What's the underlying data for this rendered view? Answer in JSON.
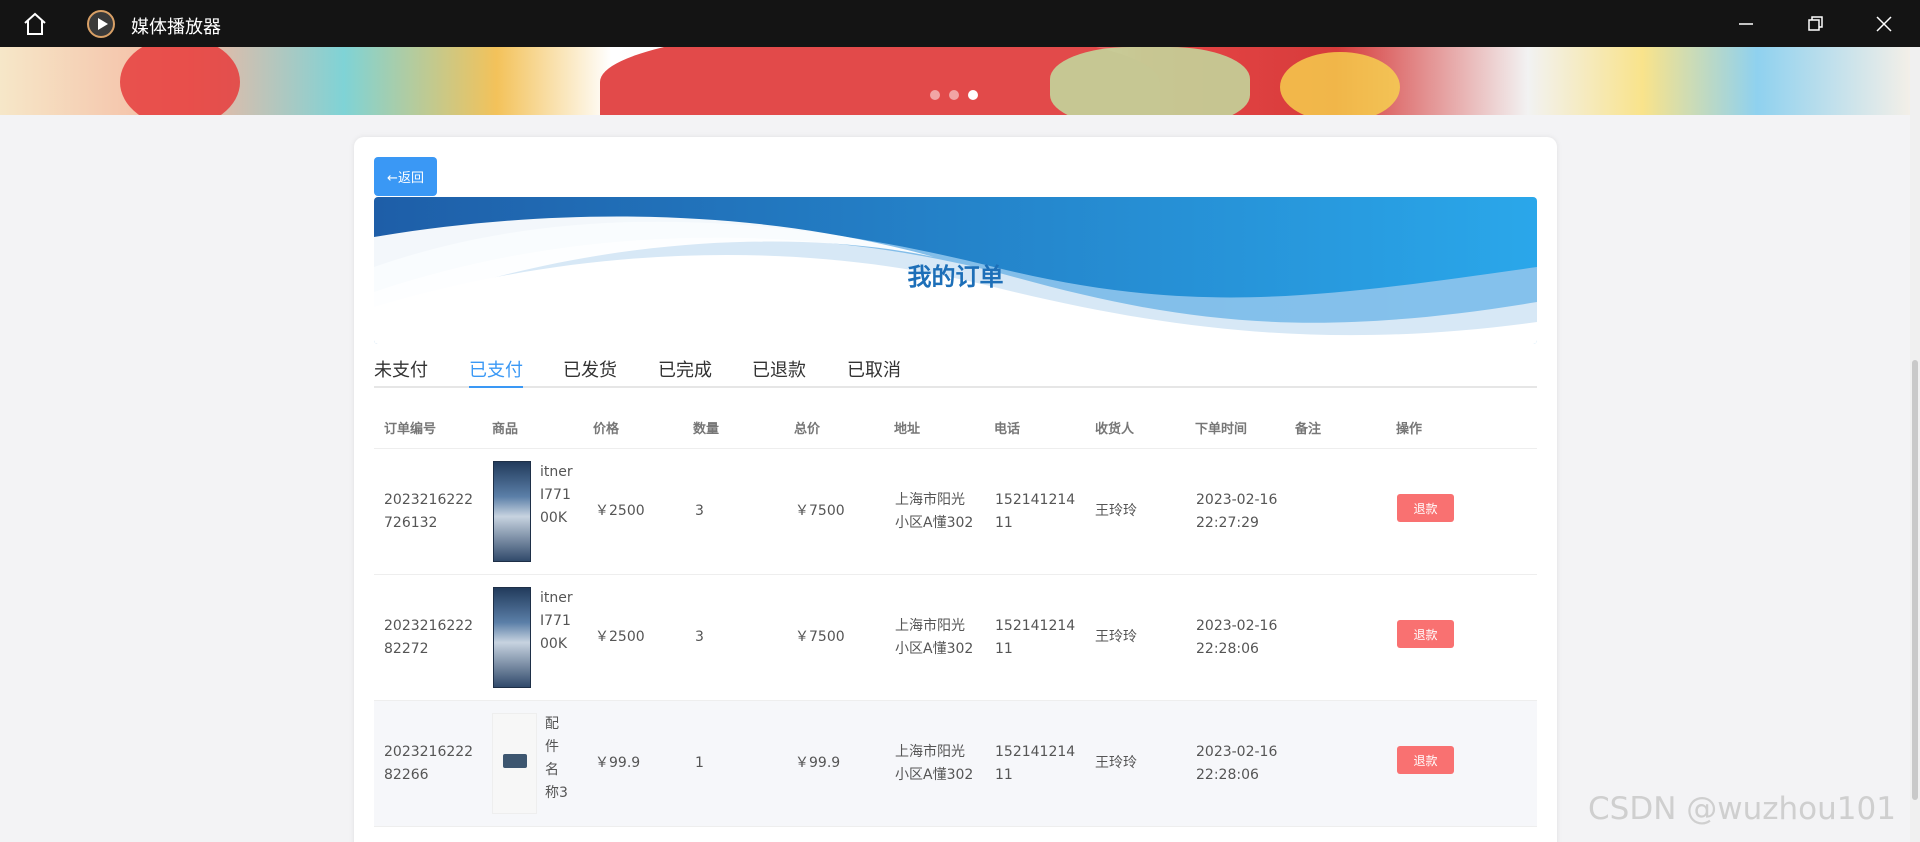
{
  "window": {
    "title": "媒体播放器"
  },
  "banner": {
    "dots": 3,
    "active_dot": 2
  },
  "page": {
    "back_label": "←返回",
    "heading": "我的订单"
  },
  "tabs": [
    {
      "label": "未支付",
      "active": false
    },
    {
      "label": "已支付",
      "active": true
    },
    {
      "label": "已发货",
      "active": false
    },
    {
      "label": "已完成",
      "active": false
    },
    {
      "label": "已退款",
      "active": false
    },
    {
      "label": "已取消",
      "active": false
    }
  ],
  "table": {
    "headers": [
      "订单编号",
      "商品",
      "价格",
      "数量",
      "总价",
      "地址",
      "电话",
      "收货人",
      "下单时间",
      "备注",
      "操作"
    ],
    "rows": [
      {
        "order_no": [
          "2023216222",
          "726132"
        ],
        "product": [
          "itner",
          "I771",
          "00K"
        ],
        "price": "￥2500",
        "qty": "3",
        "total": "￥7500",
        "address": [
          "上海市阳光",
          "小区A懂302"
        ],
        "phone": [
          "152141214",
          "11"
        ],
        "receiver": "王玲玲",
        "time": [
          "2023-02-16",
          "22:27:29"
        ],
        "note": "",
        "action": "退款"
      },
      {
        "order_no": [
          "2023216222",
          "82272"
        ],
        "product": [
          "itner",
          "I771",
          "00K"
        ],
        "price": "￥2500",
        "qty": "3",
        "total": "￥7500",
        "address": [
          "上海市阳光",
          "小区A懂302"
        ],
        "phone": [
          "152141214",
          "11"
        ],
        "receiver": "王玲玲",
        "time": [
          "2023-02-16",
          "22:28:06"
        ],
        "note": "",
        "action": "退款"
      },
      {
        "order_no": [
          "2023216222",
          "82266"
        ],
        "product": [
          "配",
          "件",
          "名",
          "称3"
        ],
        "price": "￥99.9",
        "qty": "1",
        "total": "￥99.9",
        "address": [
          "上海市阳光",
          "小区A懂302"
        ],
        "phone": [
          "152141214",
          "11"
        ],
        "receiver": "王玲玲",
        "time": [
          "2023-02-16",
          "22:28:06"
        ],
        "note": "",
        "action": "退款"
      }
    ]
  },
  "watermark": "CSDN @wuzhou101",
  "colors": {
    "accent": "#3a98f5",
    "refund": "#f97171",
    "heading": "#1d6fb8"
  }
}
